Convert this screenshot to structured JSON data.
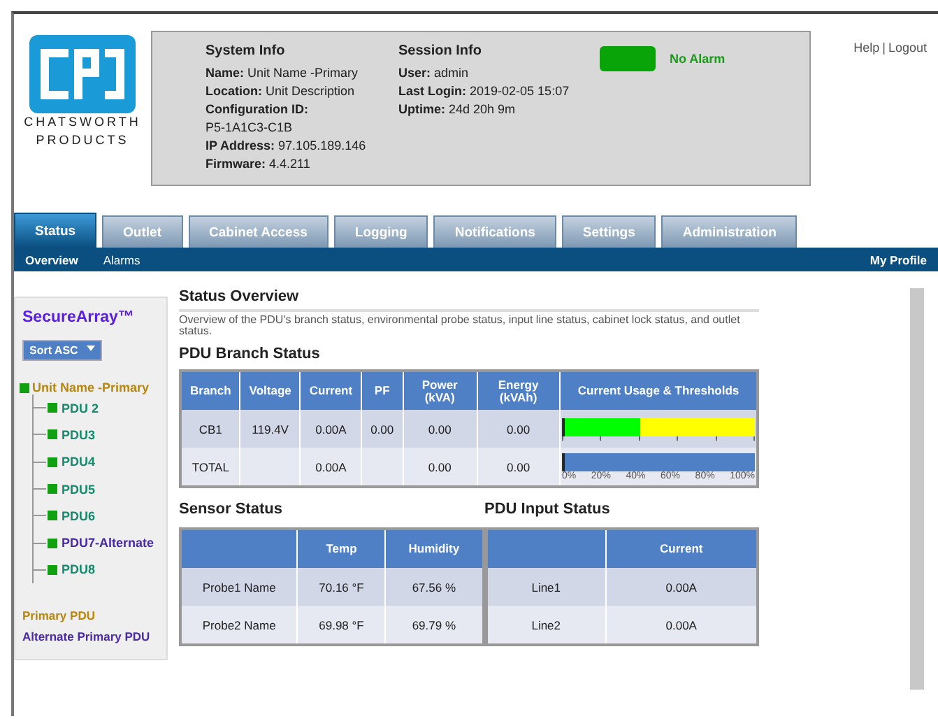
{
  "header": {
    "logo_text": [
      "CHATSWORTH",
      "PRODUCTS"
    ],
    "system_info": {
      "title": "System Info",
      "fields": [
        {
          "label": "Name:",
          "value": "Unit Name -Primary"
        },
        {
          "label": "Location:",
          "value": "Unit Description"
        },
        {
          "label": "Configuration ID:"
        },
        {
          "value": "P5-1A1C3-C1B"
        },
        {
          "label": "IP Address:",
          "value": "97.105.189.146"
        },
        {
          "label": "Firmware:",
          "value": "4.4.211"
        }
      ]
    },
    "session_info": {
      "title": "Session Info",
      "fields": [
        {
          "label": "User:",
          "value": "admin"
        },
        {
          "label": "Last Login:",
          "value": "2019-02-05 15:07"
        },
        {
          "label": "Uptime:",
          "value": "24d 20h 9m"
        }
      ]
    },
    "alarm": {
      "kind": "ok",
      "label": "No Alarm"
    },
    "links": [
      "Help",
      "|",
      "Logout"
    ]
  },
  "tabs": [
    {
      "label": "Status",
      "selected": true
    },
    {
      "label": "Outlet",
      "selected": false
    },
    {
      "label": "Cabinet Access",
      "selected": false
    },
    {
      "label": "Logging",
      "selected": false
    },
    {
      "label": "Notifications",
      "selected": false
    },
    {
      "label": "Settings",
      "selected": false
    },
    {
      "label": "Administration",
      "selected": false
    }
  ],
  "subnav": {
    "items": [
      {
        "label": "Overview",
        "selected": true
      },
      {
        "label": "Alarms",
        "selected": false
      }
    ],
    "right": "My Profile"
  },
  "sidebar": {
    "title": "SecureArray™",
    "sort": "Sort ASC",
    "tree": [
      {
        "label": "Unit Name -Primary",
        "kind": "primary",
        "children": [
          {
            "label": "PDU 2",
            "kind": "member"
          },
          {
            "label": "PDU3",
            "kind": "member"
          },
          {
            "label": "PDU4",
            "kind": "member"
          },
          {
            "label": "PDU5",
            "kind": "member"
          },
          {
            "label": "PDU6",
            "kind": "member"
          },
          {
            "label": "PDU7-Alternate",
            "kind": "alternate"
          },
          {
            "label": "PDU8",
            "kind": "member"
          }
        ]
      }
    ],
    "legend": [
      {
        "label": "Primary PDU",
        "kind": "primary"
      },
      {
        "label": "Alternate Primary PDU",
        "kind": "alternate"
      }
    ]
  },
  "overview": {
    "title": "Status Overview",
    "description": "Overview of the PDU's branch status, environmental probe status, input line status, cabinet lock status, and outlet status."
  },
  "branch_status": {
    "title": "PDU Branch Status",
    "columns": [
      "Branch",
      "Voltage",
      "Current",
      "PF",
      "Power (kVA)",
      "Energy (kVAh)",
      "Current Usage & Thresholds"
    ],
    "rows": [
      {
        "cells": [
          "CB1",
          "119.4V",
          "0.00A",
          "0.00",
          "0.00",
          "0.00"
        ],
        "usage": {
          "kind": "thresholds",
          "level": 0,
          "zones": [
            {
              "color": "#00ff00",
              "level": 0.4
            },
            {
              "color": "#ffff00",
              "level": 0.6
            }
          ]
        }
      },
      {
        "cells": [
          "TOTAL",
          "",
          "0.00A",
          "",
          "0.00",
          "0.00"
        ],
        "usage": {
          "kind": "plain",
          "level": 0,
          "zones": [
            {
              "color": "#4f7fc4",
              "level": 1
            }
          ]
        }
      }
    ],
    "scale": [
      "0%",
      "20%",
      "40%",
      "60%",
      "80%",
      "100%"
    ]
  },
  "sensor_status": {
    "title": "Sensor Status",
    "columns": [
      "",
      "Temp",
      "Humidity"
    ],
    "rows": [
      [
        "Probe1 Name",
        "70.16 °F",
        "67.56 %"
      ],
      [
        "Probe2 Name",
        "69.98 °F",
        "69.79 %"
      ]
    ]
  },
  "input_status": {
    "title": "PDU Input Status",
    "columns": [
      "",
      "Current"
    ],
    "rows": [
      [
        "Line1",
        "0.00A"
      ],
      [
        "Line2",
        "0.00A"
      ]
    ]
  }
}
